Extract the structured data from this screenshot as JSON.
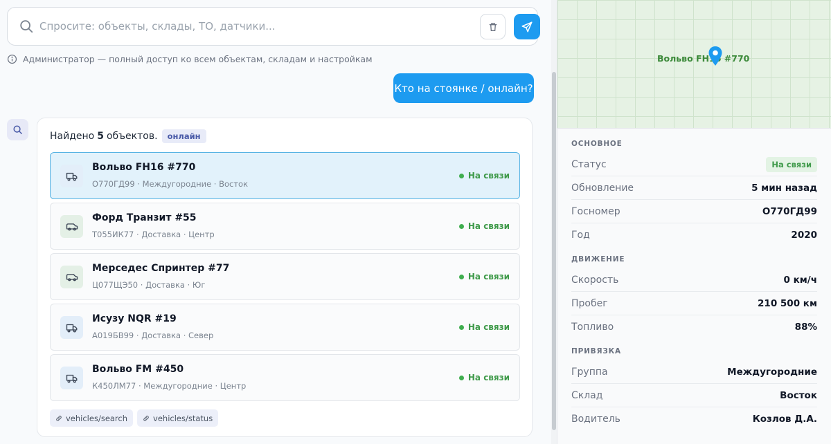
{
  "search": {
    "placeholder": "Спросите: объекты, склады, ТО, датчики..."
  },
  "role_note": "Администратор — полный доступ ко всем объектам, складам и настройкам",
  "user_message": "Кто на стоянке / онлайн?",
  "result": {
    "prefix": "Найдено",
    "count": "5",
    "suffix": "объектов.",
    "filter_badge": "онлайн",
    "vehicles": [
      {
        "name": "Вольво FH16 #770",
        "meta": "О770ГД99 · Междугородние · Восток",
        "status": "На связи",
        "icon": "truck-icon",
        "selected": true
      },
      {
        "name": "Форд Транзит #55",
        "meta": "Т055ИК77 · Доставка · Центр",
        "status": "На связи",
        "icon": "van-icon",
        "selected": false
      },
      {
        "name": "Мерседес Спринтер #77",
        "meta": "Ц077ЩЭ50 · Доставка · Юг",
        "status": "На связи",
        "icon": "van-icon",
        "selected": false
      },
      {
        "name": "Исузу NQR #19",
        "meta": "А019БВ99 · Доставка · Север",
        "status": "На связи",
        "icon": "truck-icon",
        "selected": false
      },
      {
        "name": "Вольво FM #450",
        "meta": "К450ЛМ77 · Междугородние · Центр",
        "status": "На связи",
        "icon": "truck-icon",
        "selected": false
      }
    ],
    "tools": [
      "vehicles/search",
      "vehicles/status"
    ]
  },
  "map": {
    "label": "Вольво FH16 #770"
  },
  "details": {
    "sections": [
      {
        "title": "ОСНОВНОЕ",
        "rows": [
          {
            "label": "Статус",
            "value": "На связи",
            "pill": true
          },
          {
            "label": "Обновление",
            "value": "5 мин назад"
          },
          {
            "label": "Госномер",
            "value": "О770ГД99"
          },
          {
            "label": "Год",
            "value": "2020"
          }
        ]
      },
      {
        "title": "ДВИЖЕНИЕ",
        "rows": [
          {
            "label": "Скорость",
            "value": "0 км/ч"
          },
          {
            "label": "Пробег",
            "value": "210 500 км"
          },
          {
            "label": "Топливо",
            "value": "88%"
          }
        ]
      },
      {
        "title": "ПРИВЯЗКА",
        "rows": [
          {
            "label": "Группа",
            "value": "Междугородние"
          },
          {
            "label": "Склад",
            "value": "Восток"
          },
          {
            "label": "Водитель",
            "value": "Козлов Д.А."
          }
        ]
      }
    ]
  },
  "colors": {
    "accent": "#1d9bf0",
    "online": "#3f9a4a",
    "map_bg": "#e6f2e4"
  }
}
